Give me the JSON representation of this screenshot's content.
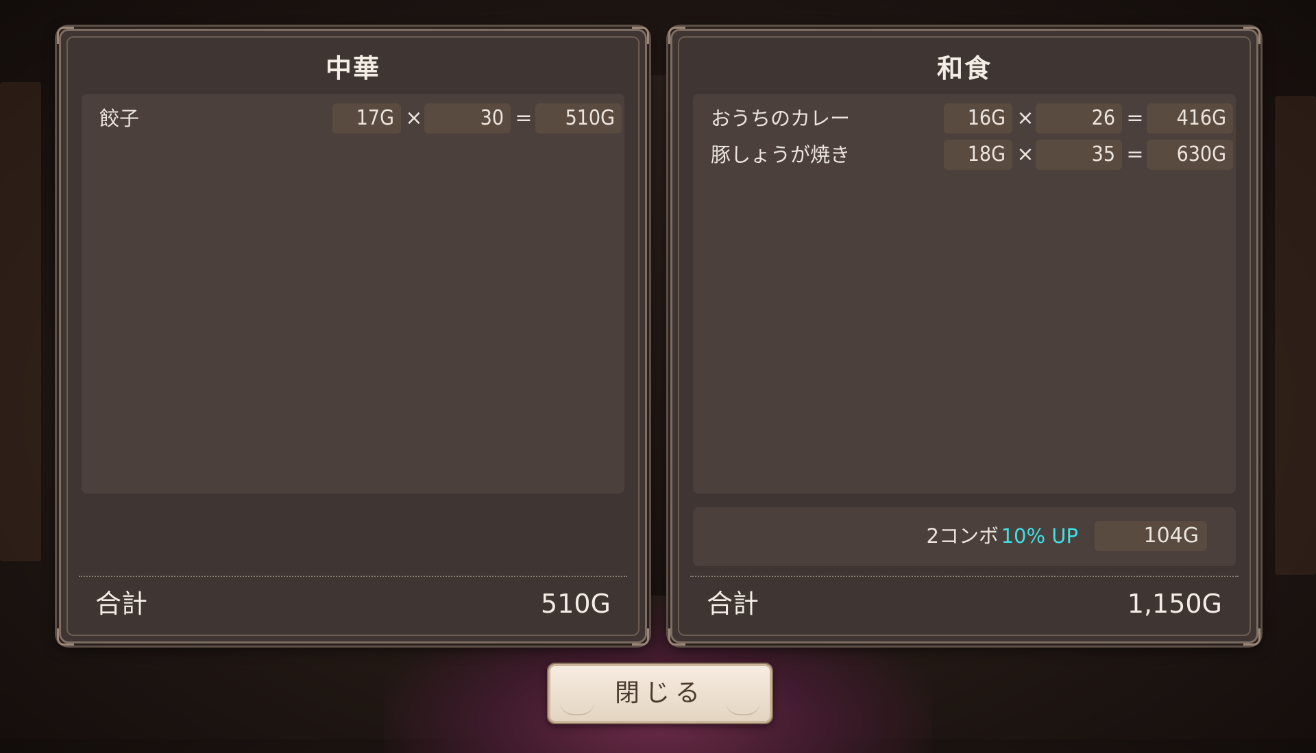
{
  "left_panel": {
    "title": "中華",
    "items": [
      {
        "name": "餃子",
        "price": "17G",
        "times": "×",
        "qty": "30",
        "eq": "=",
        "subtotal": "510G"
      }
    ],
    "total_label": "合計",
    "total_value": "510G"
  },
  "right_panel": {
    "title": "和食",
    "items": [
      {
        "name": "おうちのカレー",
        "price": "16G",
        "times": "×",
        "qty": "26",
        "eq": "=",
        "subtotal": "416G"
      },
      {
        "name": "豚しょうが焼き",
        "price": "18G",
        "times": "×",
        "qty": "35",
        "eq": "=",
        "subtotal": "630G"
      }
    ],
    "combo": {
      "label": "2コンボ",
      "bonus": "10% UP",
      "value": "104G"
    },
    "total_label": "合計",
    "total_value": "1,150G"
  },
  "close_button": {
    "label": "閉じる"
  },
  "colors": {
    "panel": "#3f3532",
    "cell": "#5a4b41",
    "combo_accent": "#3fe0e6"
  }
}
